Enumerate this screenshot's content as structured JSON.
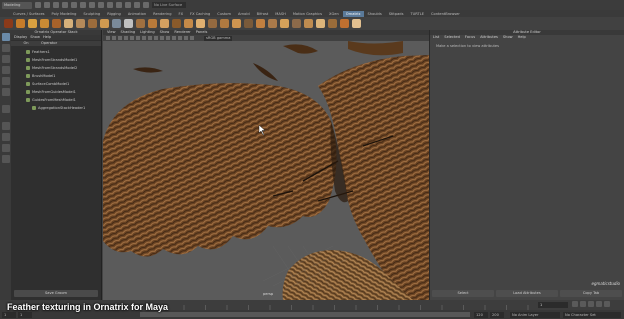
{
  "status_line": {
    "mode": "Modeling",
    "field": "No Live Surface"
  },
  "shelf_tabs": [
    "Curves / Surfaces",
    "Poly Modeling",
    "Sculpting",
    "Rigging",
    "Animation",
    "Rendering",
    "FX",
    "FX Caching",
    "Custom",
    "Arnold",
    "Bifrost",
    "MASH",
    "Motion Graphics",
    "XGen",
    "Ornatrix",
    "Shoulds",
    "Stitpads",
    "TURTLE",
    "ContentBrowser"
  ],
  "shelf_active": "Ornatrix",
  "shelf_colors": [
    "#8b3a1a",
    "#c77c2a",
    "#d8a040",
    "#c98a34",
    "#a8622a",
    "#d6b07a",
    "#b58a5a",
    "#9c6c3c",
    "#d09a50",
    "#7a8a9a",
    "#c0c0c0",
    "#a07040",
    "#b87a3a",
    "#d4a060",
    "#8a5a2a",
    "#c68a48",
    "#e0b070",
    "#946a40",
    "#b07a40",
    "#cf9550",
    "#7a5a3a",
    "#c28040",
    "#aa7a4a",
    "#d6a25a",
    "#8c6a4a",
    "#bf8c50",
    "#ddb57a",
    "#9a6c3a",
    "#c07030",
    "#e2c090"
  ],
  "outliner": {
    "title": "Ornatrix Operator Stack",
    "menus": [
      "Display",
      "Show",
      "Help"
    ],
    "header": [
      "On",
      "Operator"
    ],
    "items": [
      "Feathers1",
      "MeshFromStrandsModel1",
      "MeshFromStrandsModel2",
      "BrushModel1",
      "SurfaceCombModel1",
      "MeshFromGuidesModel1",
      "GuidesFromMeshModel1",
      "AggregationStackHeader1"
    ],
    "save_button": "Save Groom"
  },
  "viewport": {
    "menus": [
      "View",
      "Shading",
      "Lighting",
      "Show",
      "Renderer",
      "Panels"
    ],
    "gamma": "sRGB gamma",
    "camera": "persp"
  },
  "attribute_editor": {
    "title": "Attribute Editor",
    "menus": [
      "List",
      "Selected",
      "Focus",
      "Attributes",
      "Show",
      "Help"
    ],
    "message": "Make a selection to view attributes",
    "footer": [
      "Select",
      "Load Attributes",
      "Copy Tab"
    ],
    "logo": "egmaticstudio"
  },
  "time_slider": {
    "current_frame": "1",
    "ticks": 24
  },
  "range": {
    "start": "1",
    "start2": "1",
    "end": "120",
    "end2": "200",
    "anim_layer": "No Anim Layer",
    "char_set": "No Character Set"
  },
  "caption": "Feather texturing in Ornatrix for Maya"
}
